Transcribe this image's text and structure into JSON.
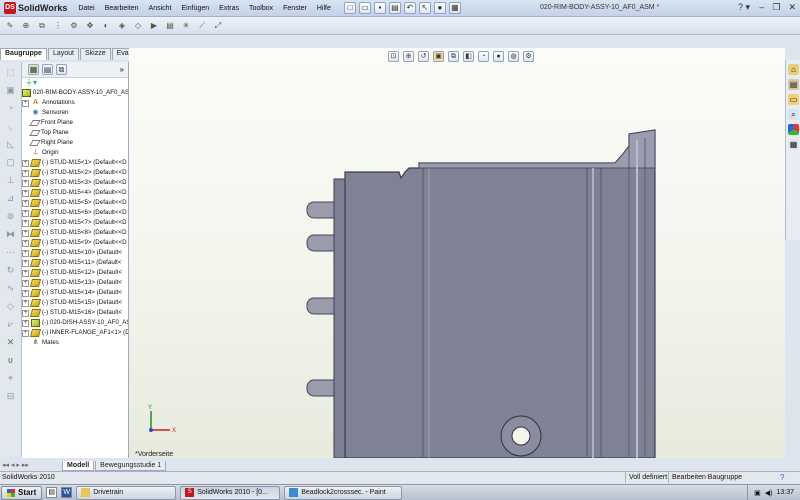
{
  "app": {
    "logo_text": "SolidWorks",
    "document_title": "020-RIM-BODY-ASSY-10_AF0_ASM *"
  },
  "menus": [
    "Datei",
    "Bearbeiten",
    "Ansicht",
    "Einfügen",
    "Extras",
    "Toolbox",
    "Fenster",
    "Hilfe"
  ],
  "tabs": [
    "Baugruppe",
    "Layout",
    "Skizze",
    "Evaluieren"
  ],
  "tree": {
    "root": "020-RIM-BODY-ASSY-10_AF0_ASM",
    "items": [
      {
        "label": "Annotations",
        "icon": "annotations-icon",
        "expand": true
      },
      {
        "label": "Sensoren",
        "icon": "sensors-icon",
        "expand": false
      },
      {
        "label": "Front Plane",
        "icon": "plane-icon",
        "expand": false
      },
      {
        "label": "Top Plane",
        "icon": "plane-icon",
        "expand": false
      },
      {
        "label": "Right Plane",
        "icon": "plane-icon",
        "expand": false
      },
      {
        "label": "Origin",
        "icon": "origin-icon",
        "expand": false
      },
      {
        "label": "(-) STUD-M15<1> (Default<<D",
        "icon": "part-icon",
        "expand": true
      },
      {
        "label": "(-) STUD-M15<2> (Default<<D",
        "icon": "part-icon",
        "expand": true
      },
      {
        "label": "(-) STUD-M15<3> (Default<<D",
        "icon": "part-icon",
        "expand": true
      },
      {
        "label": "(-) STUD-M15<4> (Default<<D",
        "icon": "part-icon",
        "expand": true
      },
      {
        "label": "(-) STUD-M15<5> (Default<<D",
        "icon": "part-icon",
        "expand": true
      },
      {
        "label": "(-) STUD-M15<6> (Default<<D",
        "icon": "part-icon",
        "expand": true
      },
      {
        "label": "(-) STUD-M15<7> (Default<<D",
        "icon": "part-icon",
        "expand": true
      },
      {
        "label": "(-) STUD-M15<8> (Default<<D",
        "icon": "part-icon",
        "expand": true
      },
      {
        "label": "(-) STUD-M15<9> (Default<<D",
        "icon": "part-icon",
        "expand": true
      },
      {
        "label": "(-) STUD-M15<10> (Default<",
        "icon": "part-icon",
        "expand": true
      },
      {
        "label": "(-) STUD-M15<11> (Default<",
        "icon": "part-icon",
        "expand": true
      },
      {
        "label": "(-) STUD-M15<12> (Default<",
        "icon": "part-icon",
        "expand": true
      },
      {
        "label": "(-) STUD-M15<13> (Default<",
        "icon": "part-icon",
        "expand": true
      },
      {
        "label": "(-) STUD-M15<14> (Default<",
        "icon": "part-icon",
        "expand": true
      },
      {
        "label": "(-) STUD-M15<15> (Default<",
        "icon": "part-icon",
        "expand": true
      },
      {
        "label": "(-) STUD-M15<16> (Default<",
        "icon": "part-icon",
        "expand": true
      },
      {
        "label": "(-) 020-DISH-ASSY-10_AF0_AS",
        "icon": "assembly-icon",
        "expand": true
      },
      {
        "label": "(-) INNER-FLANGE_AF1<1> (D",
        "icon": "part-icon",
        "expand": true
      },
      {
        "label": "Mates",
        "icon": "mates-icon",
        "expand": false
      }
    ]
  },
  "viewport": {
    "view_label": "*Vorderseite"
  },
  "bottom_tabs": [
    "Modell",
    "Bewegungsstudie 1"
  ],
  "status": {
    "app": "SolidWorks 2010",
    "definition": "Voll definiert",
    "editing": "Bearbeiten Baugruppe"
  },
  "taskbar": {
    "start": "Start",
    "buttons": [
      "Drivetrain",
      "SolidWorks 2010 - [0...",
      "Beadlock2crosssec. - Paint"
    ],
    "time": "13:37"
  },
  "colors": {
    "solidworks_red": "#c4161c",
    "viewport_bg": "#f4f6ee",
    "part_body": "#7c7f92"
  }
}
